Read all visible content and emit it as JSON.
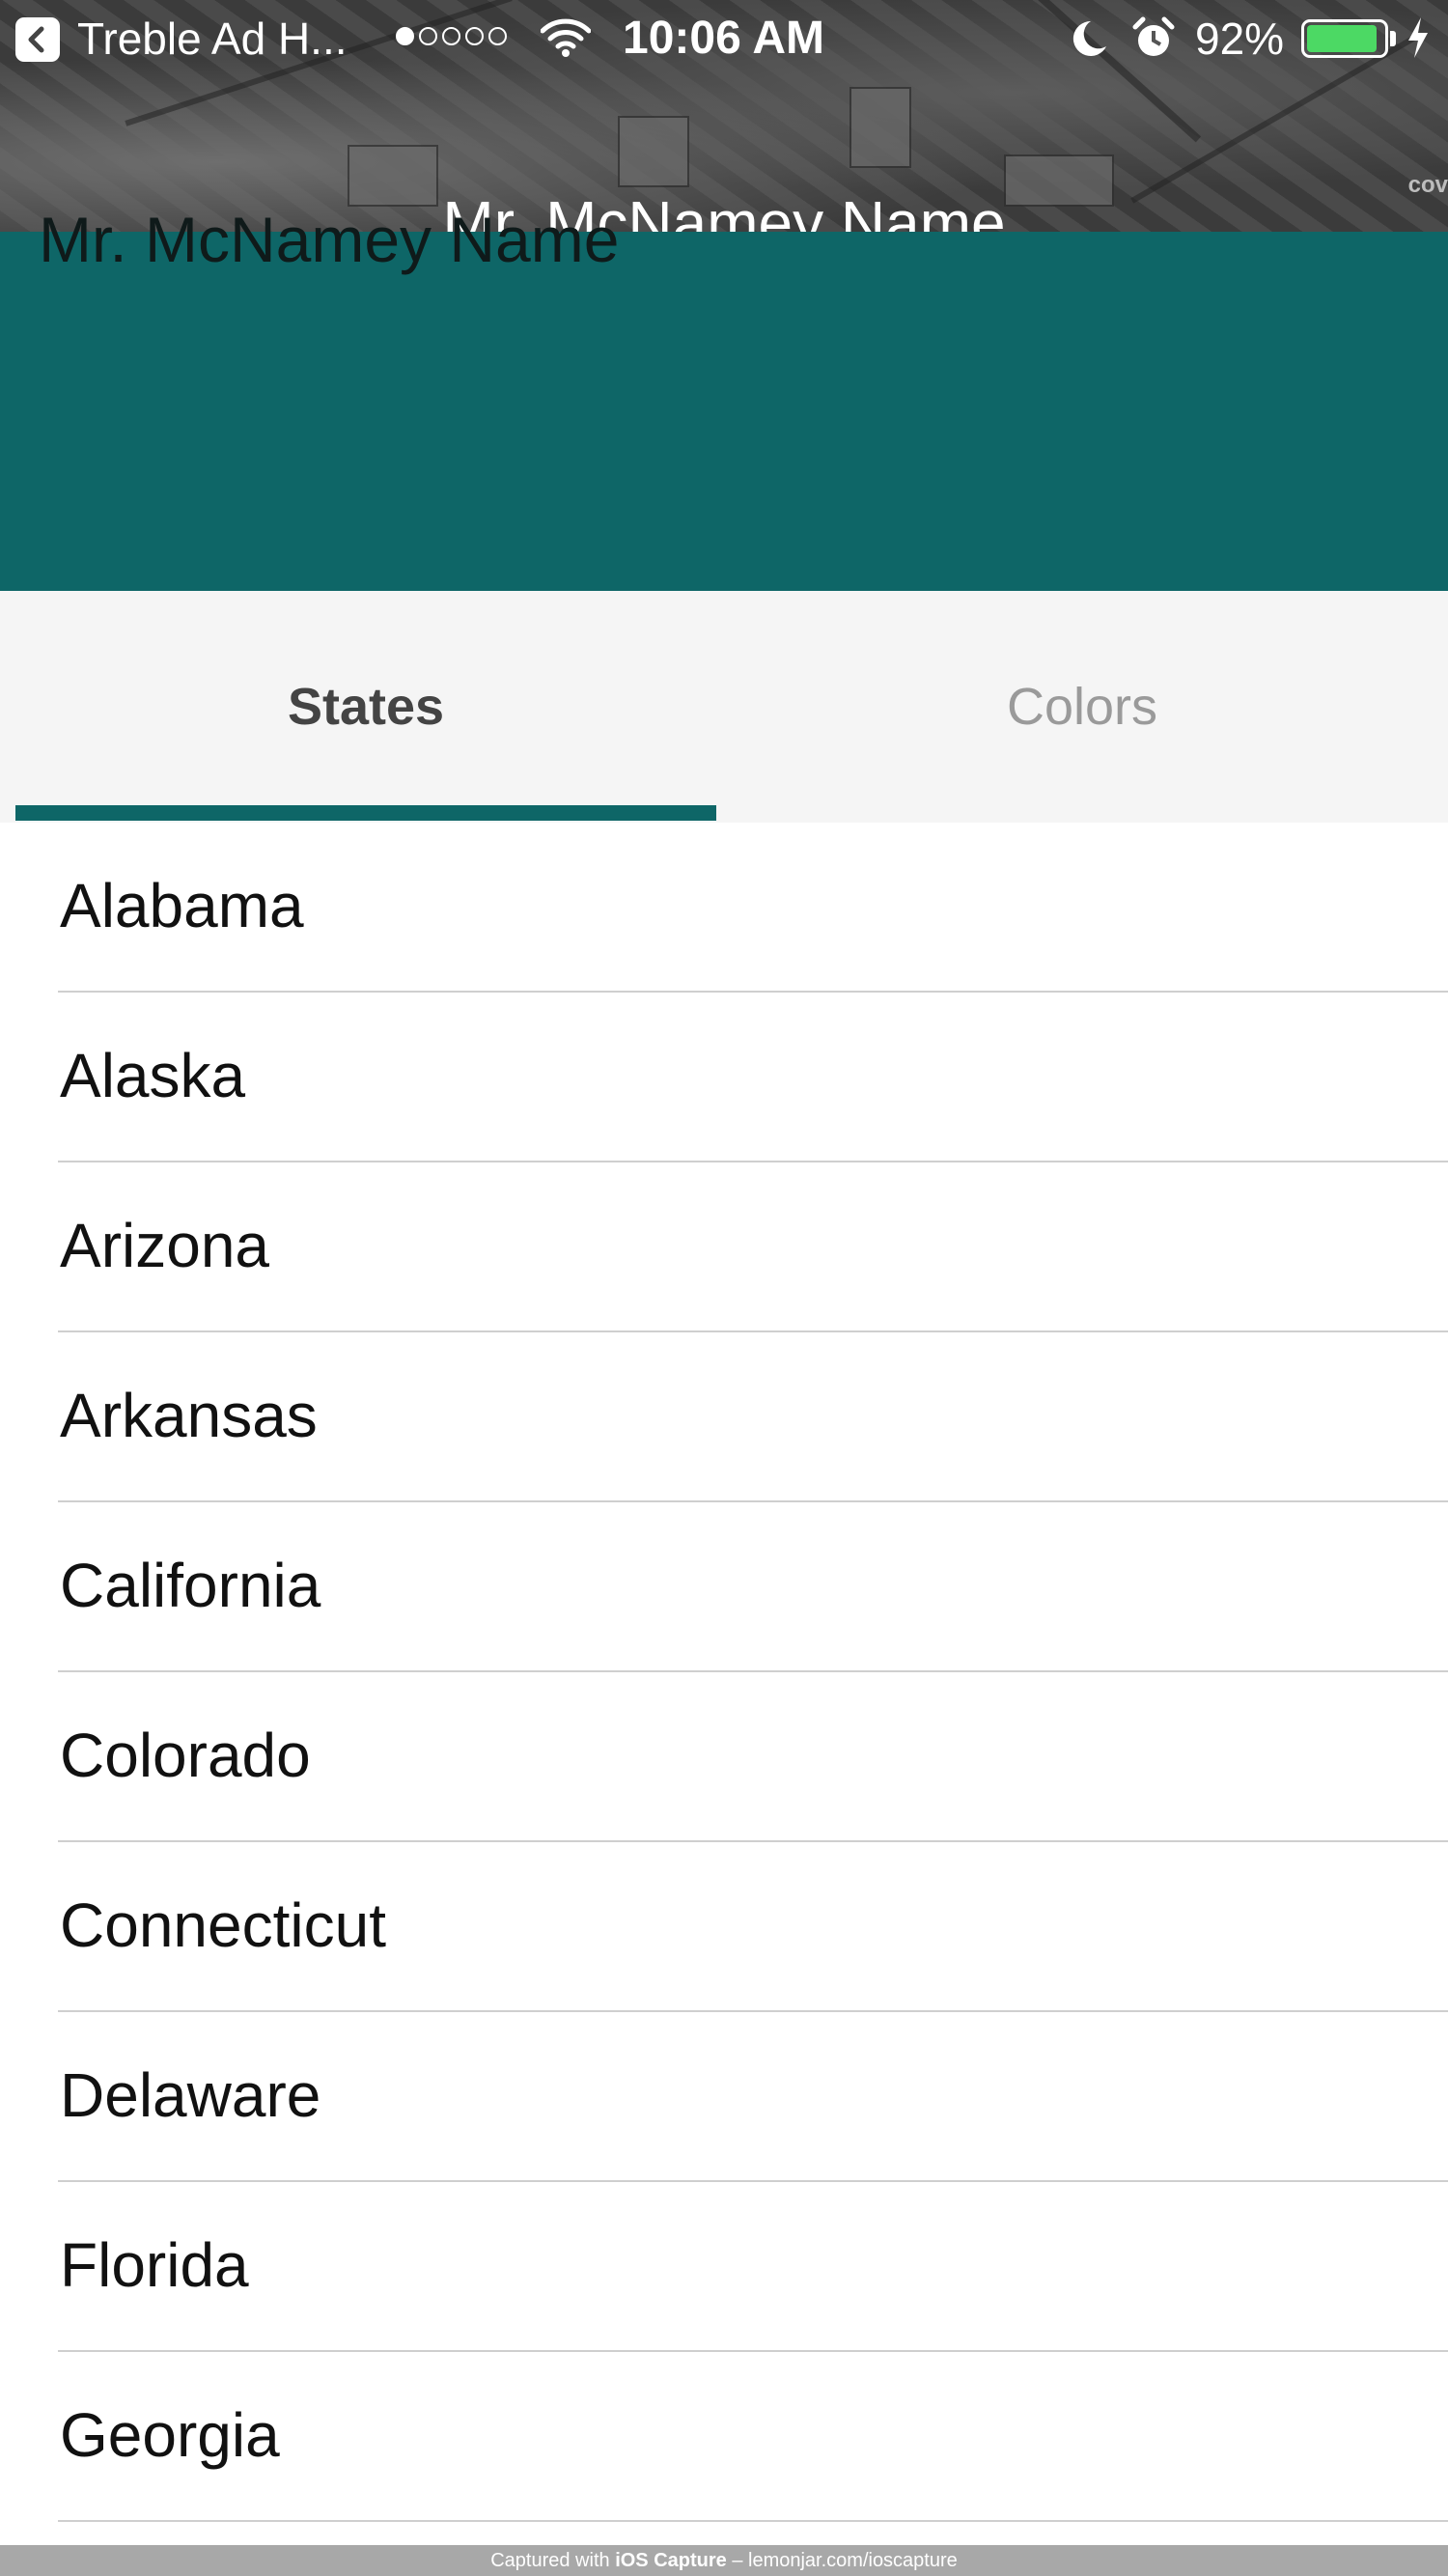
{
  "status_bar": {
    "back_app": "Treble Ad H...",
    "signal_filled": 1,
    "signal_total": 5,
    "time": "10:06 AM",
    "battery_percent": "92%",
    "battery_level": 0.92,
    "battery_color": "#4cd964"
  },
  "hero": {
    "watermark": "cov",
    "title": "Mr. McNamey Name"
  },
  "header": {
    "name": "Mr. McNamey Name",
    "accent_color": "#0e6667"
  },
  "tabs": [
    {
      "label": "States",
      "selected": true
    },
    {
      "label": "Colors",
      "selected": false
    }
  ],
  "states": [
    "Alabama",
    "Alaska",
    "Arizona",
    "Arkansas",
    "California",
    "Colorado",
    "Connecticut",
    "Delaware",
    "Florida",
    "Georgia"
  ],
  "capture": {
    "prefix": "Captured with ",
    "app": "iOS Capture",
    "suffix": " – lemonjar.com/ioscapture"
  },
  "icons": {
    "back": "back-chevron-icon",
    "wifi": "wifi-icon",
    "moon": "moon-icon",
    "alarm": "alarm-icon",
    "bolt": "charging-bolt-icon"
  }
}
